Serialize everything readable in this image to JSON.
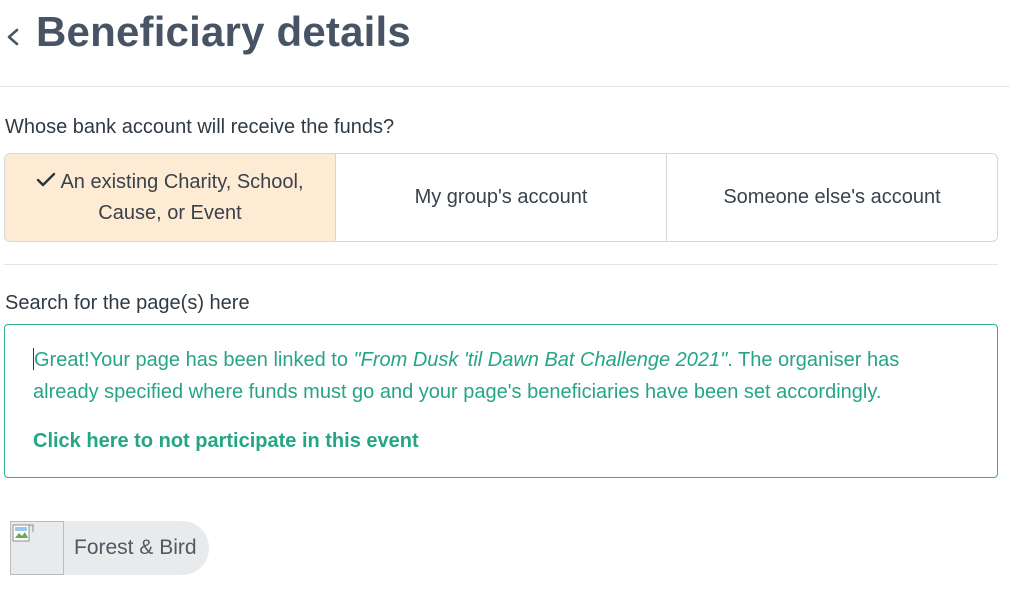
{
  "header": {
    "title": "Beneficiary details",
    "back_icon": "chevron-left-icon"
  },
  "account_question": {
    "label": "Whose bank account will receive the funds?",
    "options": [
      {
        "label": "An existing Charity, School, Cause, or Event",
        "selected": true,
        "icon": "check-icon"
      },
      {
        "label": "My group's account",
        "selected": false
      },
      {
        "label": "Someone else's account",
        "selected": false
      }
    ]
  },
  "search": {
    "label": "Search for the page(s) here"
  },
  "notice": {
    "prefix": "Great!Your page has been linked to ",
    "event_name": "\"From Dusk 'til Dawn Bat Challenge 2021\"",
    "suffix": ". The organiser has already specified where funds must go and your page's beneficiaries have been set accordingly.",
    "link": "Click here to not participate in this event"
  },
  "beneficiaries": [
    {
      "name": "Forest & Bird",
      "image_icon": "broken-image-icon"
    }
  ],
  "colors": {
    "accent_green": "#25a584",
    "selected_bg": "#fdebd4",
    "title": "#475466"
  }
}
